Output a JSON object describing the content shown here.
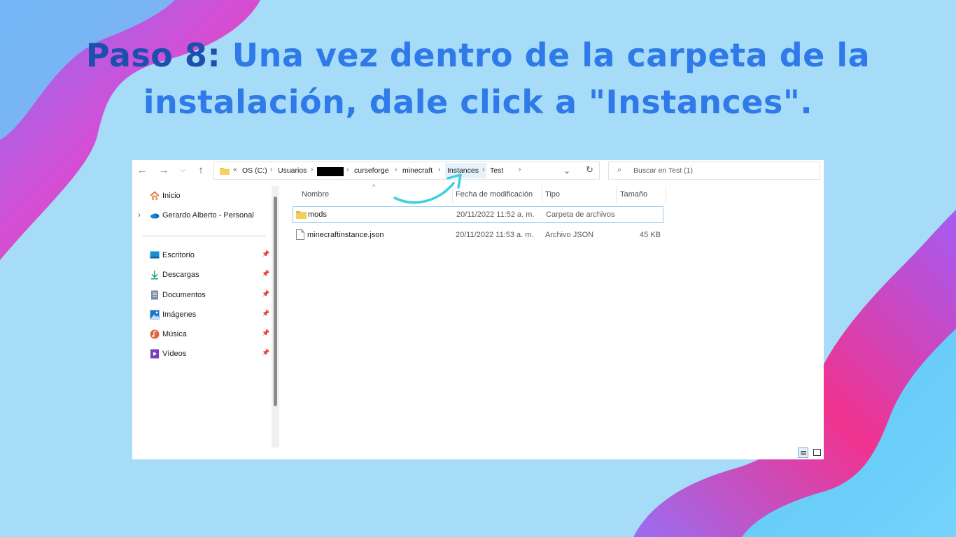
{
  "heading": {
    "step": "Paso 8:",
    "line1_rest": " Una vez dentro de la carpeta de la",
    "line2": "instalación, dale click a \"Instances\"."
  },
  "colors": {
    "background": "#a6dcf8",
    "title": "#2f7ae8",
    "step": "#1d4fae",
    "arrow": "#3ccfe0",
    "wave_pink": "#f0338f",
    "wave_purple": "#b05af0"
  },
  "explorer": {
    "toolbar": {
      "back_icon": "arrow-left-icon",
      "forward_icon": "arrow-right-icon",
      "recent_icon": "chevron-down-icon",
      "up_icon": "arrow-up-icon"
    },
    "address_bar": {
      "overflow": "«",
      "segments": [
        "OS (C:)",
        "Usuarios",
        "curseforge",
        "minecraft",
        "Instances",
        "Test"
      ],
      "redacted_segment_index": 2,
      "highlighted": "Instances"
    },
    "search": {
      "placeholder": "Buscar en Test (1)"
    },
    "sidebar": {
      "home": "Inicio",
      "cloud": "Gerardo Alberto - Personal",
      "quick_access": [
        {
          "label": "Escritorio",
          "icon": "desktop-icon"
        },
        {
          "label": "Descargas",
          "icon": "download-icon"
        },
        {
          "label": "Documentos",
          "icon": "document-icon"
        },
        {
          "label": "Imágenes",
          "icon": "pictures-icon"
        },
        {
          "label": "Música",
          "icon": "music-icon"
        },
        {
          "label": "Vídeos",
          "icon": "videos-icon"
        }
      ]
    },
    "columns": {
      "name": "Nombre",
      "modified": "Fecha de modificación",
      "type": "Tipo",
      "size": "Tamaño"
    },
    "files": [
      {
        "name": "mods",
        "modified": "20/11/2022 11:52 a. m.",
        "type": "Carpeta de archivos",
        "size": "",
        "icon": "folder-icon"
      },
      {
        "name": "minecraftinstance.json",
        "modified": "20/11/2022 11:53 a. m.",
        "type": "Archivo JSON",
        "size": "45 KB",
        "icon": "file-icon"
      }
    ]
  }
}
